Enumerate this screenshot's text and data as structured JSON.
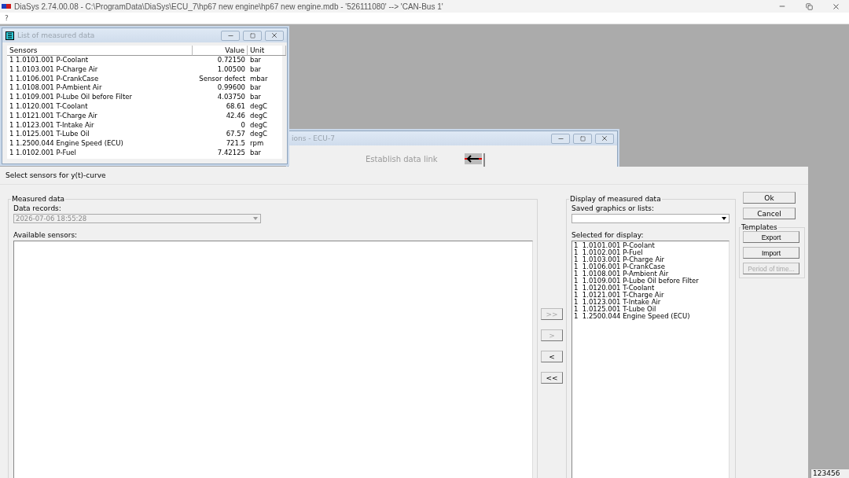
{
  "app": {
    "title": "DiaSys 2.74.00.08 - C:\\ProgramData\\DiaSys\\ECU_7\\hp67 new engine\\hp67 new engine.mdb - '526111080' --> 'CAN-Bus 1'",
    "menu": [
      "?"
    ]
  },
  "measured_list": {
    "title": "List of measured data",
    "columns": [
      "Sensors",
      "Value",
      "Unit"
    ],
    "rows": [
      {
        "channel": "1",
        "sensor": "1.0101.001 P-Coolant",
        "value": "0.72150",
        "unit": "bar"
      },
      {
        "channel": "1",
        "sensor": "1.0103.001 P-Charge Air",
        "value": "1.00500",
        "unit": "bar"
      },
      {
        "channel": "1",
        "sensor": "1.0106.001 P-CrankCase",
        "value": "Sensor defect",
        "unit": "mbar"
      },
      {
        "channel": "1",
        "sensor": "1.0108.001 P-Ambient Air",
        "value": "0.99600",
        "unit": "bar"
      },
      {
        "channel": "1",
        "sensor": "1.0109.001 P-Lube Oil before Filter",
        "value": "4.03750",
        "unit": "bar"
      },
      {
        "channel": "1",
        "sensor": "1.0120.001 T-Coolant",
        "value": "68.61",
        "unit": "degC"
      },
      {
        "channel": "1",
        "sensor": "1.0121.001 T-Charge Air",
        "value": "42.46",
        "unit": "degC"
      },
      {
        "channel": "1",
        "sensor": "1.0123.001 T-Intake Air",
        "value": "0",
        "unit": "degC"
      },
      {
        "channel": "1",
        "sensor": "1.0125.001 T-Lube Oil",
        "value": "67.57",
        "unit": "degC"
      },
      {
        "channel": "1",
        "sensor": "1.2500.044 Engine Speed (ECU)",
        "value": "721.5",
        "unit": "rpm"
      },
      {
        "channel": "1",
        "sensor": "1.0102.001 P-Fuel",
        "value": "7.42125",
        "unit": "bar"
      }
    ]
  },
  "ecu_window": {
    "title": "ions - ECU-7",
    "link_button": "Establish data link"
  },
  "dialog": {
    "title": "Select sensors for y(t)-curve",
    "measured_group": {
      "title": "Measured data",
      "records_label": "Data records:",
      "records_value": "2026-07-06 18:55:28",
      "records_disabled": true,
      "available_label": "Available sensors:"
    },
    "transfer_buttons": [
      {
        "label": ">>",
        "disabled": true
      },
      {
        "label": ">",
        "disabled": true
      },
      {
        "label": "<",
        "disabled": false
      },
      {
        "label": "<<",
        "disabled": false
      }
    ],
    "display_group": {
      "title": "Display of measured data",
      "saved_label": "Saved graphics or lists:",
      "selected_label": "Selected for display:",
      "selected": [
        {
          "channel": "1",
          "sensor": "1.0101.001 P-Coolant"
        },
        {
          "channel": "1",
          "sensor": "1.0102.001 P-Fuel"
        },
        {
          "channel": "1",
          "sensor": "1.0103.001 P-Charge Air"
        },
        {
          "channel": "1",
          "sensor": "1.0106.001 P-CrankCase"
        },
        {
          "channel": "1",
          "sensor": "1.0108.001 P-Ambient Air"
        },
        {
          "channel": "1",
          "sensor": "1.0109.001 P-Lube Oil before Filter"
        },
        {
          "channel": "1",
          "sensor": "1.0120.001 T-Coolant"
        },
        {
          "channel": "1",
          "sensor": "1.0121.001 T-Charge Air"
        },
        {
          "channel": "1",
          "sensor": "1.0123.001 T-Intake Air"
        },
        {
          "channel": "1",
          "sensor": "1.0125.001 T-Lube Oil"
        },
        {
          "channel": "1",
          "sensor": "1.2500.044 Engine Speed (ECU)"
        }
      ]
    },
    "buttons": [
      {
        "label": "Ok",
        "disabled": false
      },
      {
        "label": "Cancel",
        "disabled": false
      }
    ],
    "templates": {
      "title": "Templates",
      "buttons": [
        {
          "label": "Export",
          "disabled": false
        },
        {
          "label": "Import",
          "disabled": false
        },
        {
          "label": "Period of time...",
          "disabled": true
        }
      ]
    }
  },
  "status_bar": {
    "field": "123456"
  }
}
